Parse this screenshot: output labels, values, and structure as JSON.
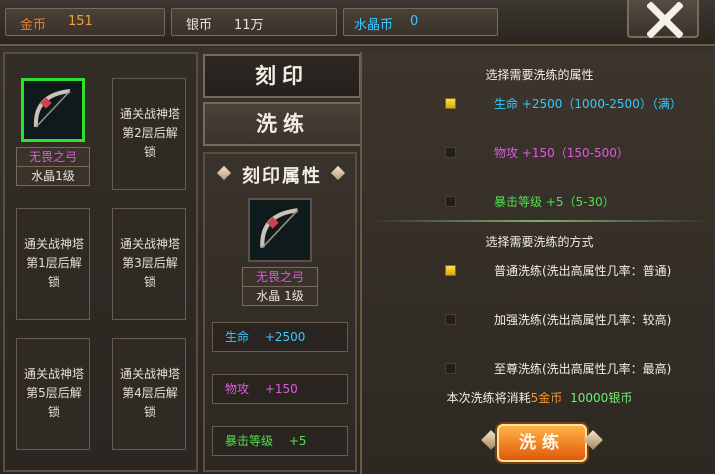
{
  "currency": {
    "gold": {
      "label": "金币",
      "value": "151"
    },
    "silver": {
      "label": "银币",
      "value": "11万"
    },
    "crystal": {
      "label": "水晶币",
      "value": "0"
    }
  },
  "tabs": [
    {
      "label": "刻印",
      "active": false
    },
    {
      "label": "洗练",
      "active": true
    }
  ],
  "slots": {
    "equipped": {
      "name": "无畏之弓",
      "level": "水晶1级"
    },
    "locked": [
      "通关战神塔第2层后解锁",
      "通关战神塔第1层后解锁",
      "通关战神塔第3层后解锁",
      "通关战神塔第5层后解锁",
      "通关战神塔第4层后解锁"
    ]
  },
  "engrave": {
    "title": "刻印属性",
    "item_name": "无畏之弓",
    "item_level": "水晶 1级",
    "stats": [
      {
        "name": "生命",
        "value": "+2500"
      },
      {
        "name": "物攻",
        "value": "+150"
      },
      {
        "name": "暴击等级",
        "value": "+5"
      }
    ]
  },
  "refine": {
    "attr_title": "选择需要洗练的属性",
    "attrs": [
      {
        "text": "生命 +2500（1000-2500）（满）",
        "checked": true
      },
      {
        "text": "物攻 +150（150-500）",
        "checked": false
      },
      {
        "text": "暴击等级 +5（5-30）",
        "checked": false
      }
    ],
    "mode_title": "选择需要洗练的方式",
    "modes": [
      {
        "text": "普通洗练(洗出高属性几率：普通)",
        "checked": true
      },
      {
        "text": "加强洗练(洗出高属性几率：较高)",
        "checked": false
      },
      {
        "text": "至尊洗练(洗出高属性几率：最高)",
        "checked": false
      }
    ],
    "cost_prefix": "本次洗练将消耗",
    "cost_gold": "5金币",
    "cost_silver": "10000银币",
    "button_label": "洗练"
  },
  "colors": {
    "accent": "#f07b2b",
    "cyan": "#36c9ff",
    "purple": "#e05ae0",
    "green": "#4fe04f"
  }
}
